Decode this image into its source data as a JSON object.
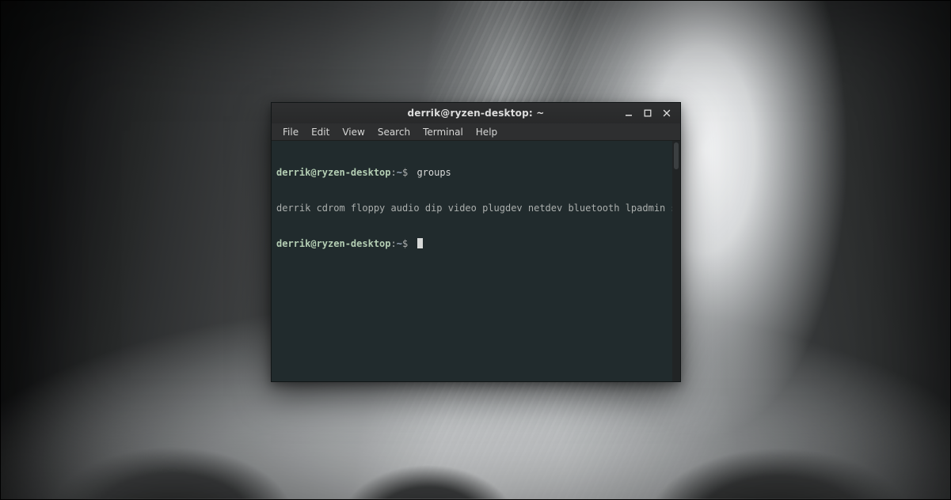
{
  "window": {
    "title": "derrik@ryzen-desktop: ~"
  },
  "menubar": {
    "items": [
      "File",
      "Edit",
      "View",
      "Search",
      "Terminal",
      "Help"
    ]
  },
  "prompt": {
    "userhost": "derrik@ryzen-desktop",
    "separator": ":",
    "path": "~",
    "sigil": "$"
  },
  "terminal": {
    "lines": [
      {
        "type": "prompt",
        "command": "groups"
      },
      {
        "type": "output",
        "text": "derrik cdrom floppy audio dip video plugdev netdev bluetooth lpadmin scanner"
      },
      {
        "type": "prompt",
        "command": "",
        "cursor": true
      }
    ]
  },
  "controls": {
    "minimize": "minimize",
    "maximize": "maximize",
    "close": "close"
  }
}
